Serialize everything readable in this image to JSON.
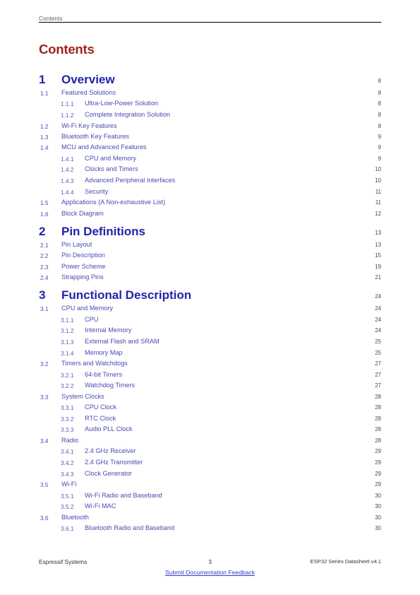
{
  "header": {
    "running_head": "Contents"
  },
  "title": "Contents",
  "toc": {
    "entries": [
      {
        "level": 0,
        "number": "1",
        "title": "Overview",
        "page": "8"
      },
      {
        "level": 1,
        "number": "1.1",
        "title": "Featured Solutions",
        "page": "8"
      },
      {
        "level": 2,
        "number": "1.1.1",
        "title": "Ultra-Low-Power Solution",
        "page": "8"
      },
      {
        "level": 2,
        "number": "1.1.2",
        "title": "Complete Integration Solution",
        "page": "8"
      },
      {
        "level": 1,
        "number": "1.2",
        "title": "Wi-Fi Key Features",
        "page": "8"
      },
      {
        "level": 1,
        "number": "1.3",
        "title": "Bluetooth Key Features",
        "page": "9"
      },
      {
        "level": 1,
        "number": "1.4",
        "title": "MCU and Advanced Features",
        "page": "9"
      },
      {
        "level": 2,
        "number": "1.4.1",
        "title": "CPU and Memory",
        "page": "9"
      },
      {
        "level": 2,
        "number": "1.4.2",
        "title": "Clocks and Timers",
        "page": "10"
      },
      {
        "level": 2,
        "number": "1.4.3",
        "title": "Advanced Peripheral Interfaces",
        "page": "10"
      },
      {
        "level": 2,
        "number": "1.4.4",
        "title": "Security",
        "page": "11"
      },
      {
        "level": 1,
        "number": "1.5",
        "title": "Applications (A Non-exhaustive List)",
        "page": "11"
      },
      {
        "level": 1,
        "number": "1.6",
        "title": "Block Diagram",
        "page": "12"
      },
      {
        "level": 0,
        "number": "2",
        "title": "Pin Definitions",
        "page": "13"
      },
      {
        "level": 1,
        "number": "2.1",
        "title": "Pin Layout",
        "page": "13"
      },
      {
        "level": 1,
        "number": "2.2",
        "title": "Pin Description",
        "page": "15"
      },
      {
        "level": 1,
        "number": "2.3",
        "title": "Power Scheme",
        "page": "19"
      },
      {
        "level": 1,
        "number": "2.4",
        "title": "Strapping Pins",
        "page": "21"
      },
      {
        "level": 0,
        "number": "3",
        "title": "Functional Description",
        "page": "24"
      },
      {
        "level": 1,
        "number": "3.1",
        "title": "CPU and Memory",
        "page": "24"
      },
      {
        "level": 2,
        "number": "3.1.1",
        "title": "CPU",
        "page": "24"
      },
      {
        "level": 2,
        "number": "3.1.2",
        "title": "Internal Memory",
        "page": "24"
      },
      {
        "level": 2,
        "number": "3.1.3",
        "title": "External Flash and SRAM",
        "page": "25"
      },
      {
        "level": 2,
        "number": "3.1.4",
        "title": "Memory Map",
        "page": "25"
      },
      {
        "level": 1,
        "number": "3.2",
        "title": "Timers and Watchdogs",
        "page": "27"
      },
      {
        "level": 2,
        "number": "3.2.1",
        "title": "64-bit Timers",
        "page": "27"
      },
      {
        "level": 2,
        "number": "3.2.2",
        "title": "Watchdog Timers",
        "page": "27"
      },
      {
        "level": 1,
        "number": "3.3",
        "title": "System Clocks",
        "page": "28"
      },
      {
        "level": 2,
        "number": "3.3.1",
        "title": "CPU Clock",
        "page": "28"
      },
      {
        "level": 2,
        "number": "3.3.2",
        "title": "RTC Clock",
        "page": "28"
      },
      {
        "level": 2,
        "number": "3.3.3",
        "title": "Audio PLL Clock",
        "page": "28"
      },
      {
        "level": 1,
        "number": "3.4",
        "title": "Radio",
        "page": "28"
      },
      {
        "level": 2,
        "number": "3.4.1",
        "title": "2.4 GHz Receiver",
        "page": "29"
      },
      {
        "level": 2,
        "number": "3.4.2",
        "title": "2.4 GHz Transmitter",
        "page": "29"
      },
      {
        "level": 2,
        "number": "3.4.3",
        "title": "Clock Generator",
        "page": "29"
      },
      {
        "level": 1,
        "number": "3.5",
        "title": "Wi-Fi",
        "page": "29"
      },
      {
        "level": 2,
        "number": "3.5.1",
        "title": "Wi-Fi Radio and Baseband",
        "page": "30"
      },
      {
        "level": 2,
        "number": "3.5.2",
        "title": "Wi-Fi MAC",
        "page": "30"
      },
      {
        "level": 1,
        "number": "3.6",
        "title": "Bluetooth",
        "page": "30"
      },
      {
        "level": 2,
        "number": "3.6.1",
        "title": "Bluetooth Radio and Baseband",
        "page": "30"
      }
    ]
  },
  "footer": {
    "company": "Espressif Systems",
    "page_number": "3",
    "feedback_link": "Submit Documentation Feedback",
    "document": "ESP32 Series Datasheet v4.1"
  },
  "colors": {
    "title_red": "#a32020",
    "chapter_blue": "#2222aa",
    "section_blue": "#4a4ab5",
    "pageno_gray": "#4a4a4a",
    "header_gray": "#5a5a5a",
    "link_blue": "#3b3bc4",
    "rule_black": "#000000"
  }
}
